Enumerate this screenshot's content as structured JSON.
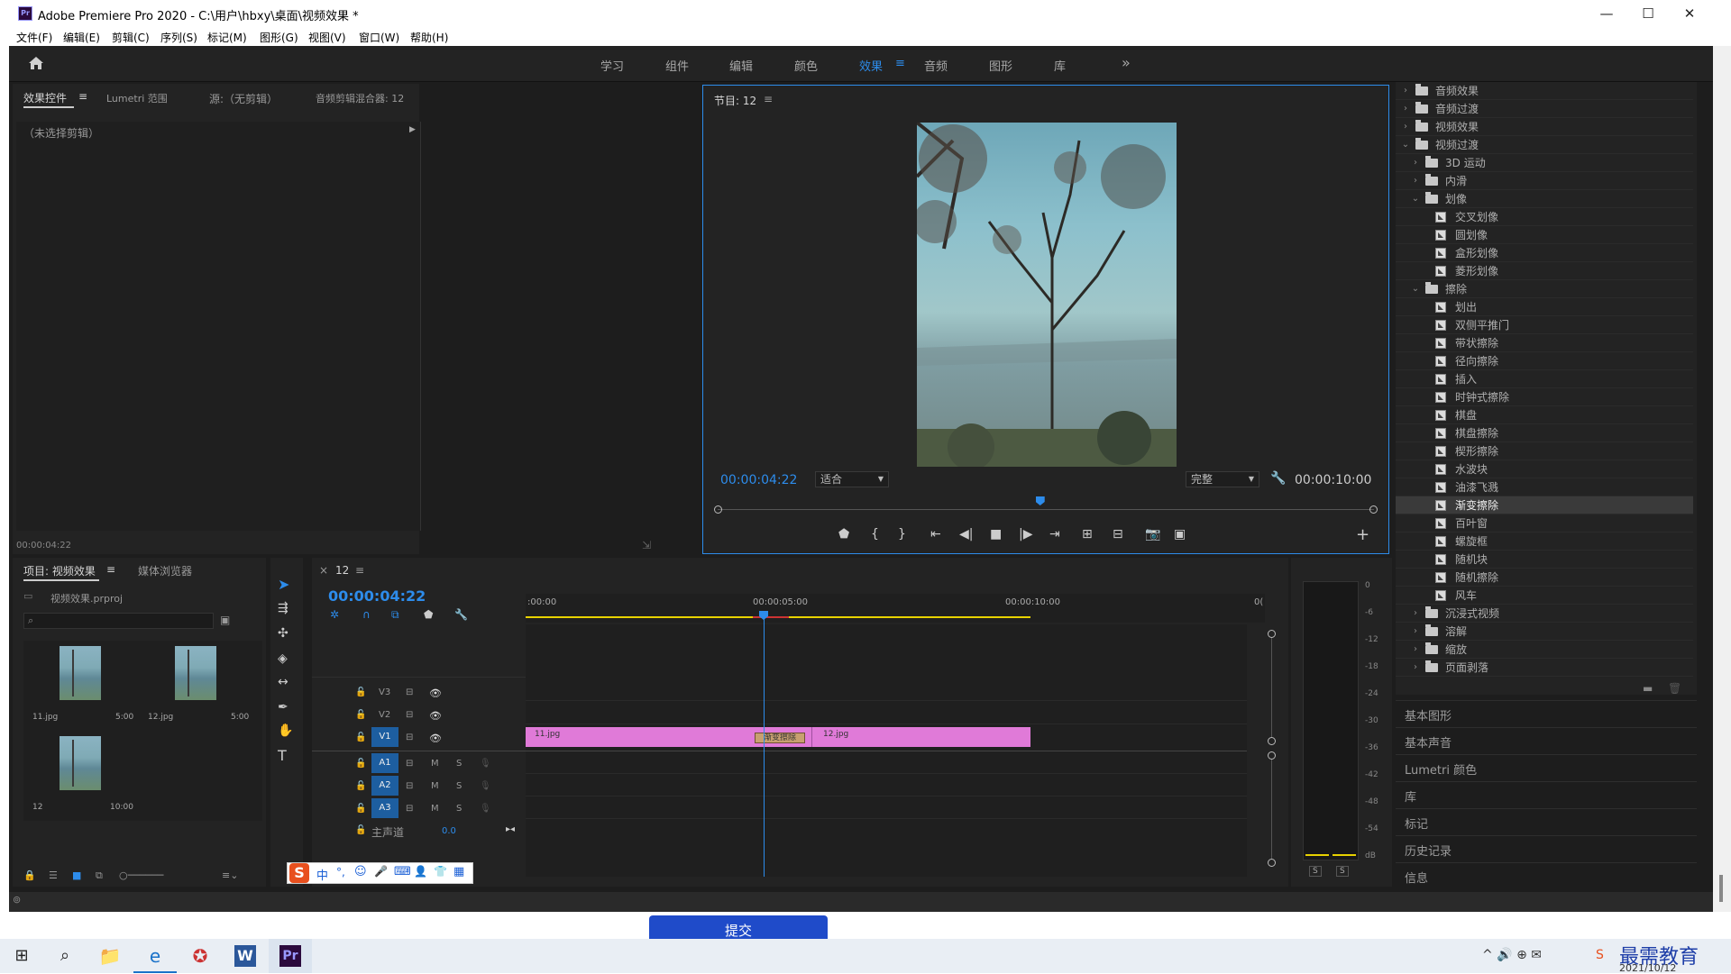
{
  "window": {
    "title": "Adobe Premiere Pro 2020 - C:\\用户\\hbxy\\桌面\\视频效果 *",
    "minimize": "—",
    "maximize": "☐",
    "close": "✕",
    "logo": "Pr"
  },
  "menu": [
    "文件(F)",
    "编辑(E)",
    "剪辑(C)",
    "序列(S)",
    "标记(M)",
    "图形(G)",
    "视图(V)",
    "窗口(W)",
    "帮助(H)"
  ],
  "workspaces": [
    "学习",
    "组件",
    "编辑",
    "颜色",
    "效果",
    "音频",
    "图形",
    "库"
  ],
  "workspace_active_index": 4,
  "workspace_more": "»",
  "source_panel": {
    "tabs": [
      "效果控件",
      "Lumetri 范围",
      "源:（无剪辑）",
      "音频剪辑混合器: 12"
    ],
    "no_clip": "（未选择剪辑）",
    "timecode": "00:00:04:22"
  },
  "program_monitor": {
    "title": "节目: 12",
    "timecode": "00:00:04:22",
    "fit": "适合",
    "quality": "完整",
    "duration": "00:00:10:00",
    "playhead": 0.49
  },
  "effects_tree": [
    {
      "label": "音频效果",
      "level": 0,
      "type": "folder",
      "open": false
    },
    {
      "label": "音频过渡",
      "level": 0,
      "type": "folder",
      "open": false
    },
    {
      "label": "视频效果",
      "level": 0,
      "type": "folder",
      "open": false
    },
    {
      "label": "视频过渡",
      "level": 0,
      "type": "folder",
      "open": true
    },
    {
      "label": "3D 运动",
      "level": 1,
      "type": "folder",
      "open": false
    },
    {
      "label": "内滑",
      "level": 1,
      "type": "folder",
      "open": false
    },
    {
      "label": "划像",
      "level": 1,
      "type": "folder",
      "open": true
    },
    {
      "label": "交叉划像",
      "level": 2,
      "type": "fx"
    },
    {
      "label": "圆划像",
      "level": 2,
      "type": "fx"
    },
    {
      "label": "盒形划像",
      "level": 2,
      "type": "fx"
    },
    {
      "label": "菱形划像",
      "level": 2,
      "type": "fx"
    },
    {
      "label": "擦除",
      "level": 1,
      "type": "folder",
      "open": true
    },
    {
      "label": "划出",
      "level": 2,
      "type": "fx"
    },
    {
      "label": "双侧平推门",
      "level": 2,
      "type": "fx"
    },
    {
      "label": "带状擦除",
      "level": 2,
      "type": "fx"
    },
    {
      "label": "径向擦除",
      "level": 2,
      "type": "fx"
    },
    {
      "label": "插入",
      "level": 2,
      "type": "fx"
    },
    {
      "label": "时钟式擦除",
      "level": 2,
      "type": "fx"
    },
    {
      "label": "棋盘",
      "level": 2,
      "type": "fx"
    },
    {
      "label": "棋盘擦除",
      "level": 2,
      "type": "fx"
    },
    {
      "label": "楔形擦除",
      "level": 2,
      "type": "fx"
    },
    {
      "label": "水波块",
      "level": 2,
      "type": "fx"
    },
    {
      "label": "油漆飞溅",
      "level": 2,
      "type": "fx"
    },
    {
      "label": "渐变擦除",
      "level": 2,
      "type": "fx",
      "selected": true
    },
    {
      "label": "百叶窗",
      "level": 2,
      "type": "fx"
    },
    {
      "label": "螺旋框",
      "level": 2,
      "type": "fx"
    },
    {
      "label": "随机块",
      "level": 2,
      "type": "fx"
    },
    {
      "label": "随机擦除",
      "level": 2,
      "type": "fx"
    },
    {
      "label": "风车",
      "level": 2,
      "type": "fx"
    },
    {
      "label": "沉浸式视频",
      "level": 1,
      "type": "folder",
      "open": false
    },
    {
      "label": "溶解",
      "level": 1,
      "type": "folder",
      "open": false
    },
    {
      "label": "缩放",
      "level": 1,
      "type": "folder",
      "open": false
    },
    {
      "label": "页面剥落",
      "level": 1,
      "type": "folder",
      "open": false
    }
  ],
  "side_sections": [
    "基本图形",
    "基本声音",
    "Lumetri 颜色",
    "库",
    "标记",
    "历史记录",
    "信息"
  ],
  "project": {
    "tabs": [
      "项目: 视频效果",
      "媒体浏览器"
    ],
    "file": "视频效果.prproj",
    "items": [
      {
        "name": "11.jpg",
        "duration": "5:00"
      },
      {
        "name": "12.jpg",
        "duration": "5:00"
      },
      {
        "name": "12",
        "duration": "10:00"
      }
    ]
  },
  "timeline": {
    "seq": "12",
    "close": "×",
    "timecode": "00:00:04:22",
    "ruler": [
      ":00:00",
      "00:00:05:00",
      "00:00:10:00",
      "0("
    ],
    "video_tracks": [
      "V3",
      "V2",
      "V1"
    ],
    "audio_tracks": [
      "A1",
      "A2",
      "A3"
    ],
    "master": "主声道",
    "master_val": "0.0",
    "mute": "M",
    "solo": "S",
    "clip1": "11.jpg",
    "clip2": "12.jpg",
    "transition": "渐变擦除"
  },
  "meter": {
    "ticks": [
      "0",
      "-6",
      "-12",
      "-18",
      "-24",
      "-30",
      "-36",
      "-42",
      "-48",
      "-54",
      "dB"
    ],
    "solo": [
      "S",
      "S"
    ]
  },
  "ime": {
    "items": [
      "中",
      "°,",
      "☺",
      "🎤",
      "⌨",
      "👤",
      "👕",
      "▦"
    ]
  },
  "submit": "提交",
  "taskbar": {
    "date": "2021/10/12",
    "watermark": "最需教育"
  },
  "colors": {
    "accent": "#2d8ceb",
    "clip": "#e07ad8",
    "yellow": "#e8d200"
  }
}
